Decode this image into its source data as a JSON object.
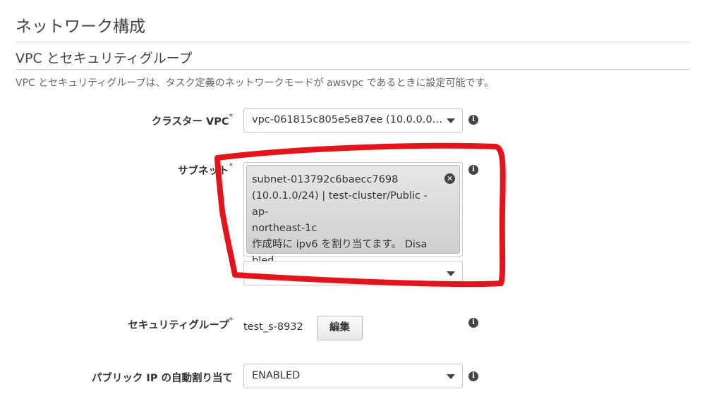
{
  "page": {
    "title": "ネットワーク構成",
    "section_title": "VPC とセキュリティグループ",
    "description": "VPC とセキュリティグループは、タスク定義のネットワークモードが awsvpc であるときに設定可能です。"
  },
  "fields": {
    "cluster_vpc": {
      "label": "クラスター VPC",
      "required_mark": "*",
      "value": "vpc-061815c805e5e87ee (10.0.0.0…"
    },
    "subnet": {
      "label": "サブネット",
      "required_mark": "*",
      "chip_lines": [
        "subnet-013792c6baecc7698",
        "(10.0.1.0/24) | test-cluster/Public - ap-",
        "northeast-1c",
        "作成時に ipv6 を割り当てます。 Disa",
        "bled"
      ],
      "remove_glyph": "✕",
      "add_value": ""
    },
    "security_group": {
      "label": "セキュリティグループ",
      "required_mark": "*",
      "value": "test_s-8932",
      "edit_label": "編集"
    },
    "public_ip": {
      "label": "パブリック IP の自動割り当て",
      "value": "ENABLED"
    }
  },
  "icons": {
    "info": "info-icon",
    "dropdown": "chevron-down-icon",
    "remove": "close-icon"
  },
  "info_glyph": "i",
  "colors": {
    "annotation": "#e3141c",
    "text": "#333333",
    "muted": "#666666",
    "border": "#c8c8c8"
  }
}
